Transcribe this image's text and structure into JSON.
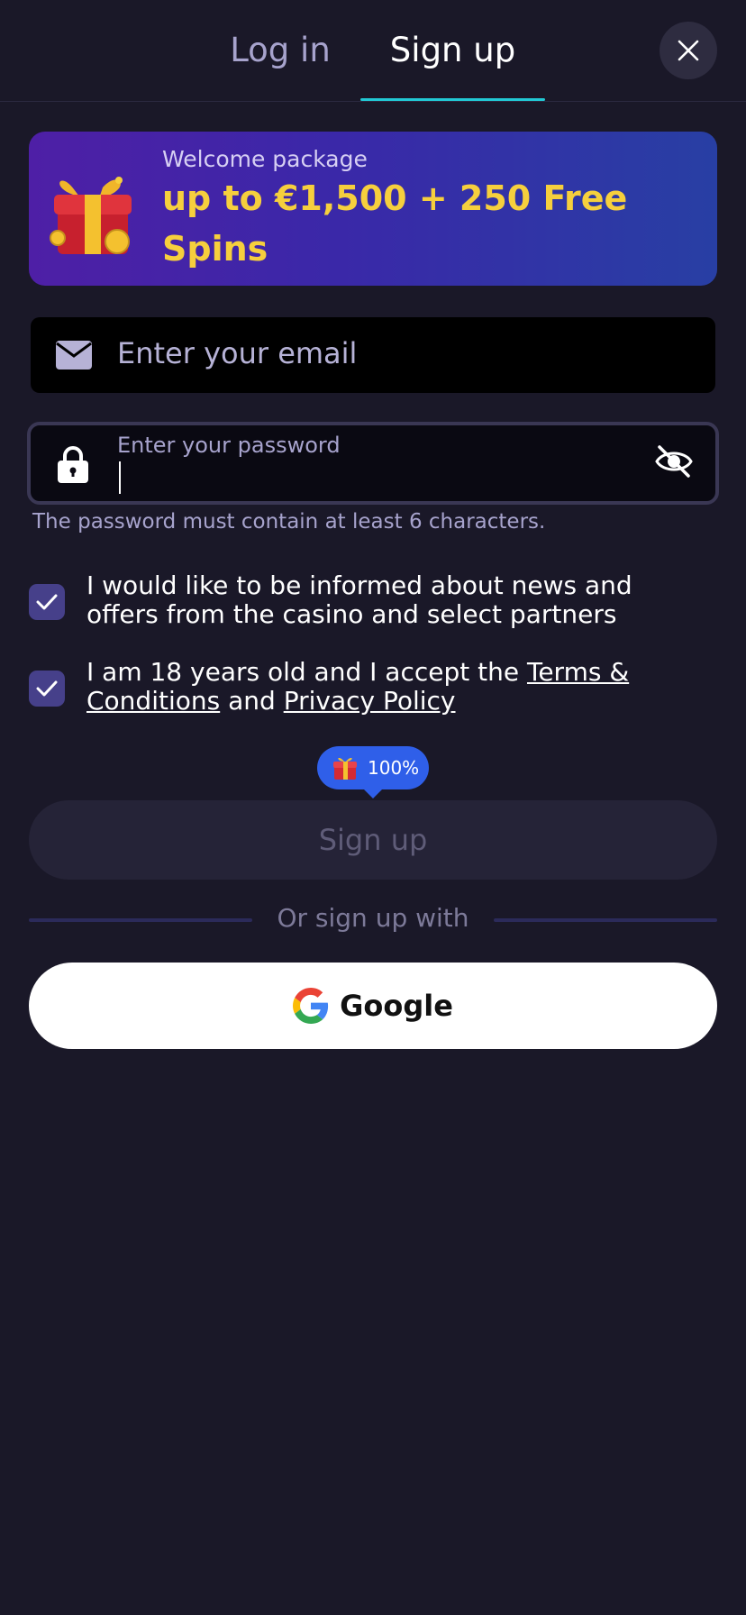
{
  "tabs": {
    "login": "Log in",
    "signup": "Sign up"
  },
  "banner": {
    "subtitle": "Welcome package",
    "title": "up to €1,500 + 250 Free Spins"
  },
  "email": {
    "placeholder": "Enter your email"
  },
  "password": {
    "label": "Enter your password",
    "hint": "The password must contain at least 6 characters."
  },
  "consents": {
    "news": {
      "text": "I would like to be informed about news and offers from the casino and select partners",
      "checked": true
    },
    "age": {
      "prefix": "I am 18 years old and I accept the ",
      "terms_link": "Terms & Conditions",
      "middle": " and ",
      "privacy_link": "Privacy Policy",
      "checked": true
    }
  },
  "bonus_badge": {
    "percent": "100%"
  },
  "signup_button": "Sign up",
  "divider": "Or sign up with",
  "google_button": "Google",
  "colors": {
    "background": "#1a1828",
    "accent_tab": "#22c8d4",
    "banner_text": "#f6cf3d",
    "checkbox": "#46408a",
    "badge": "#2f5fe9"
  },
  "icons": {
    "close": "close-icon",
    "gift": "gift-icon",
    "email": "envelope-icon",
    "lock": "lock-icon",
    "visibility": "eye-off-icon",
    "check": "checkmark-icon",
    "google": "google-logo-icon"
  }
}
